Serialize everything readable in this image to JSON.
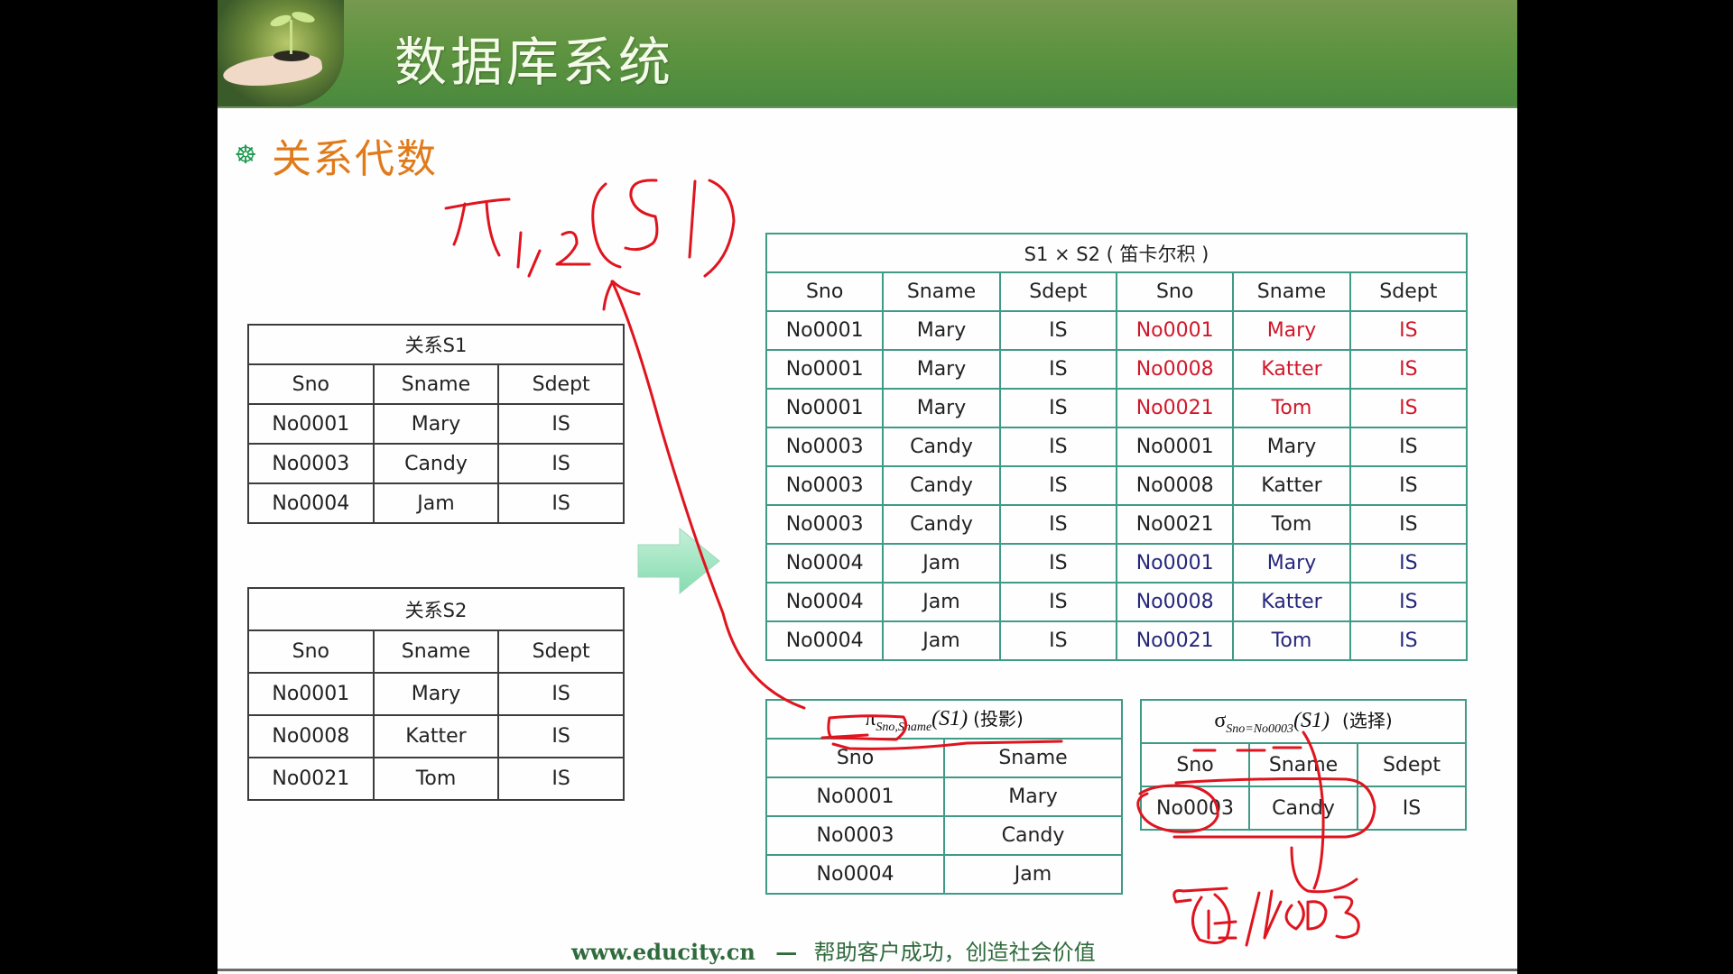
{
  "header": {
    "title": "数据库系统",
    "logo_icon": "seedling-in-hand-logo"
  },
  "section": {
    "bullet_icon": "dharma-wheel-bullet-icon",
    "title": "关系代数"
  },
  "colors": {
    "header_green": "#5f9440",
    "section_orange": "#e07a1a",
    "table_teal": "#3f9a86",
    "highlight_red": "#d0182a",
    "highlight_navy": "#26277a",
    "ink_red": "#e0141e",
    "footer_green": "#2f6b3c"
  },
  "tables": {
    "s1": {
      "caption": "关系S1",
      "columns": [
        "Sno",
        "Sname",
        "Sdept"
      ],
      "rows": [
        [
          "No0001",
          "Mary",
          "IS"
        ],
        [
          "No0003",
          "Candy",
          "IS"
        ],
        [
          "No0004",
          "Jam",
          "IS"
        ]
      ]
    },
    "s2": {
      "caption": "关系S2",
      "columns": [
        "Sno",
        "Sname",
        "Sdept"
      ],
      "rows": [
        [
          "No0001",
          "Mary",
          "IS"
        ],
        [
          "No0008",
          "Katter",
          "IS"
        ],
        [
          "No0021",
          "Tom",
          "IS"
        ]
      ]
    },
    "product": {
      "caption": "S1 × S2 ( 笛卡尔积 )",
      "columns": [
        "Sno",
        "Sname",
        "Sdept",
        "Sno",
        "Sname",
        "Sdept"
      ],
      "rows": [
        {
          "cells": [
            "No0001",
            "Mary",
            "IS",
            "No0001",
            "Mary",
            "IS"
          ],
          "highlight": "red"
        },
        {
          "cells": [
            "No0001",
            "Mary",
            "IS",
            "No0008",
            "Katter",
            "IS"
          ],
          "highlight": "red"
        },
        {
          "cells": [
            "No0001",
            "Mary",
            "IS",
            "No0021",
            "Tom",
            "IS"
          ],
          "highlight": "red"
        },
        {
          "cells": [
            "No0003",
            "Candy",
            "IS",
            "No0001",
            "Mary",
            "IS"
          ],
          "highlight": "none"
        },
        {
          "cells": [
            "No0003",
            "Candy",
            "IS",
            "No0008",
            "Katter",
            "IS"
          ],
          "highlight": "none"
        },
        {
          "cells": [
            "No0003",
            "Candy",
            "IS",
            "No0021",
            "Tom",
            "IS"
          ],
          "highlight": "none"
        },
        {
          "cells": [
            "No0004",
            "Jam",
            "IS",
            "No0001",
            "Mary",
            "IS"
          ],
          "highlight": "navy"
        },
        {
          "cells": [
            "No0004",
            "Jam",
            "IS",
            "No0008",
            "Katter",
            "IS"
          ],
          "highlight": "navy"
        },
        {
          "cells": [
            "No0004",
            "Jam",
            "IS",
            "No0021",
            "Tom",
            "IS"
          ],
          "highlight": "navy"
        }
      ]
    },
    "projection": {
      "caption_symbol": "π",
      "caption_subscript": "Sno,Sname",
      "caption_arg": "(S1)",
      "caption_note": "(投影)",
      "columns": [
        "Sno",
        "Sname"
      ],
      "rows": [
        [
          "No0001",
          "Mary"
        ],
        [
          "No0003",
          "Candy"
        ],
        [
          "No0004",
          "Jam"
        ]
      ]
    },
    "selection": {
      "caption_symbol": "σ",
      "caption_subscript": "Sno=No0003",
      "caption_arg": "(S1)",
      "caption_note": "(选择)",
      "columns": [
        "Sno",
        "Sname",
        "Sdept"
      ],
      "rows": [
        [
          "No0003",
          "Candy",
          "IS"
        ]
      ]
    }
  },
  "annotations": {
    "handwritten_projection": "π1,2(S1)",
    "handwritten_selection": "σ1=N003"
  },
  "footer": {
    "url": "www.educity.cn",
    "dash": "—",
    "slogan": "帮助客户成功，创造社会价值"
  }
}
